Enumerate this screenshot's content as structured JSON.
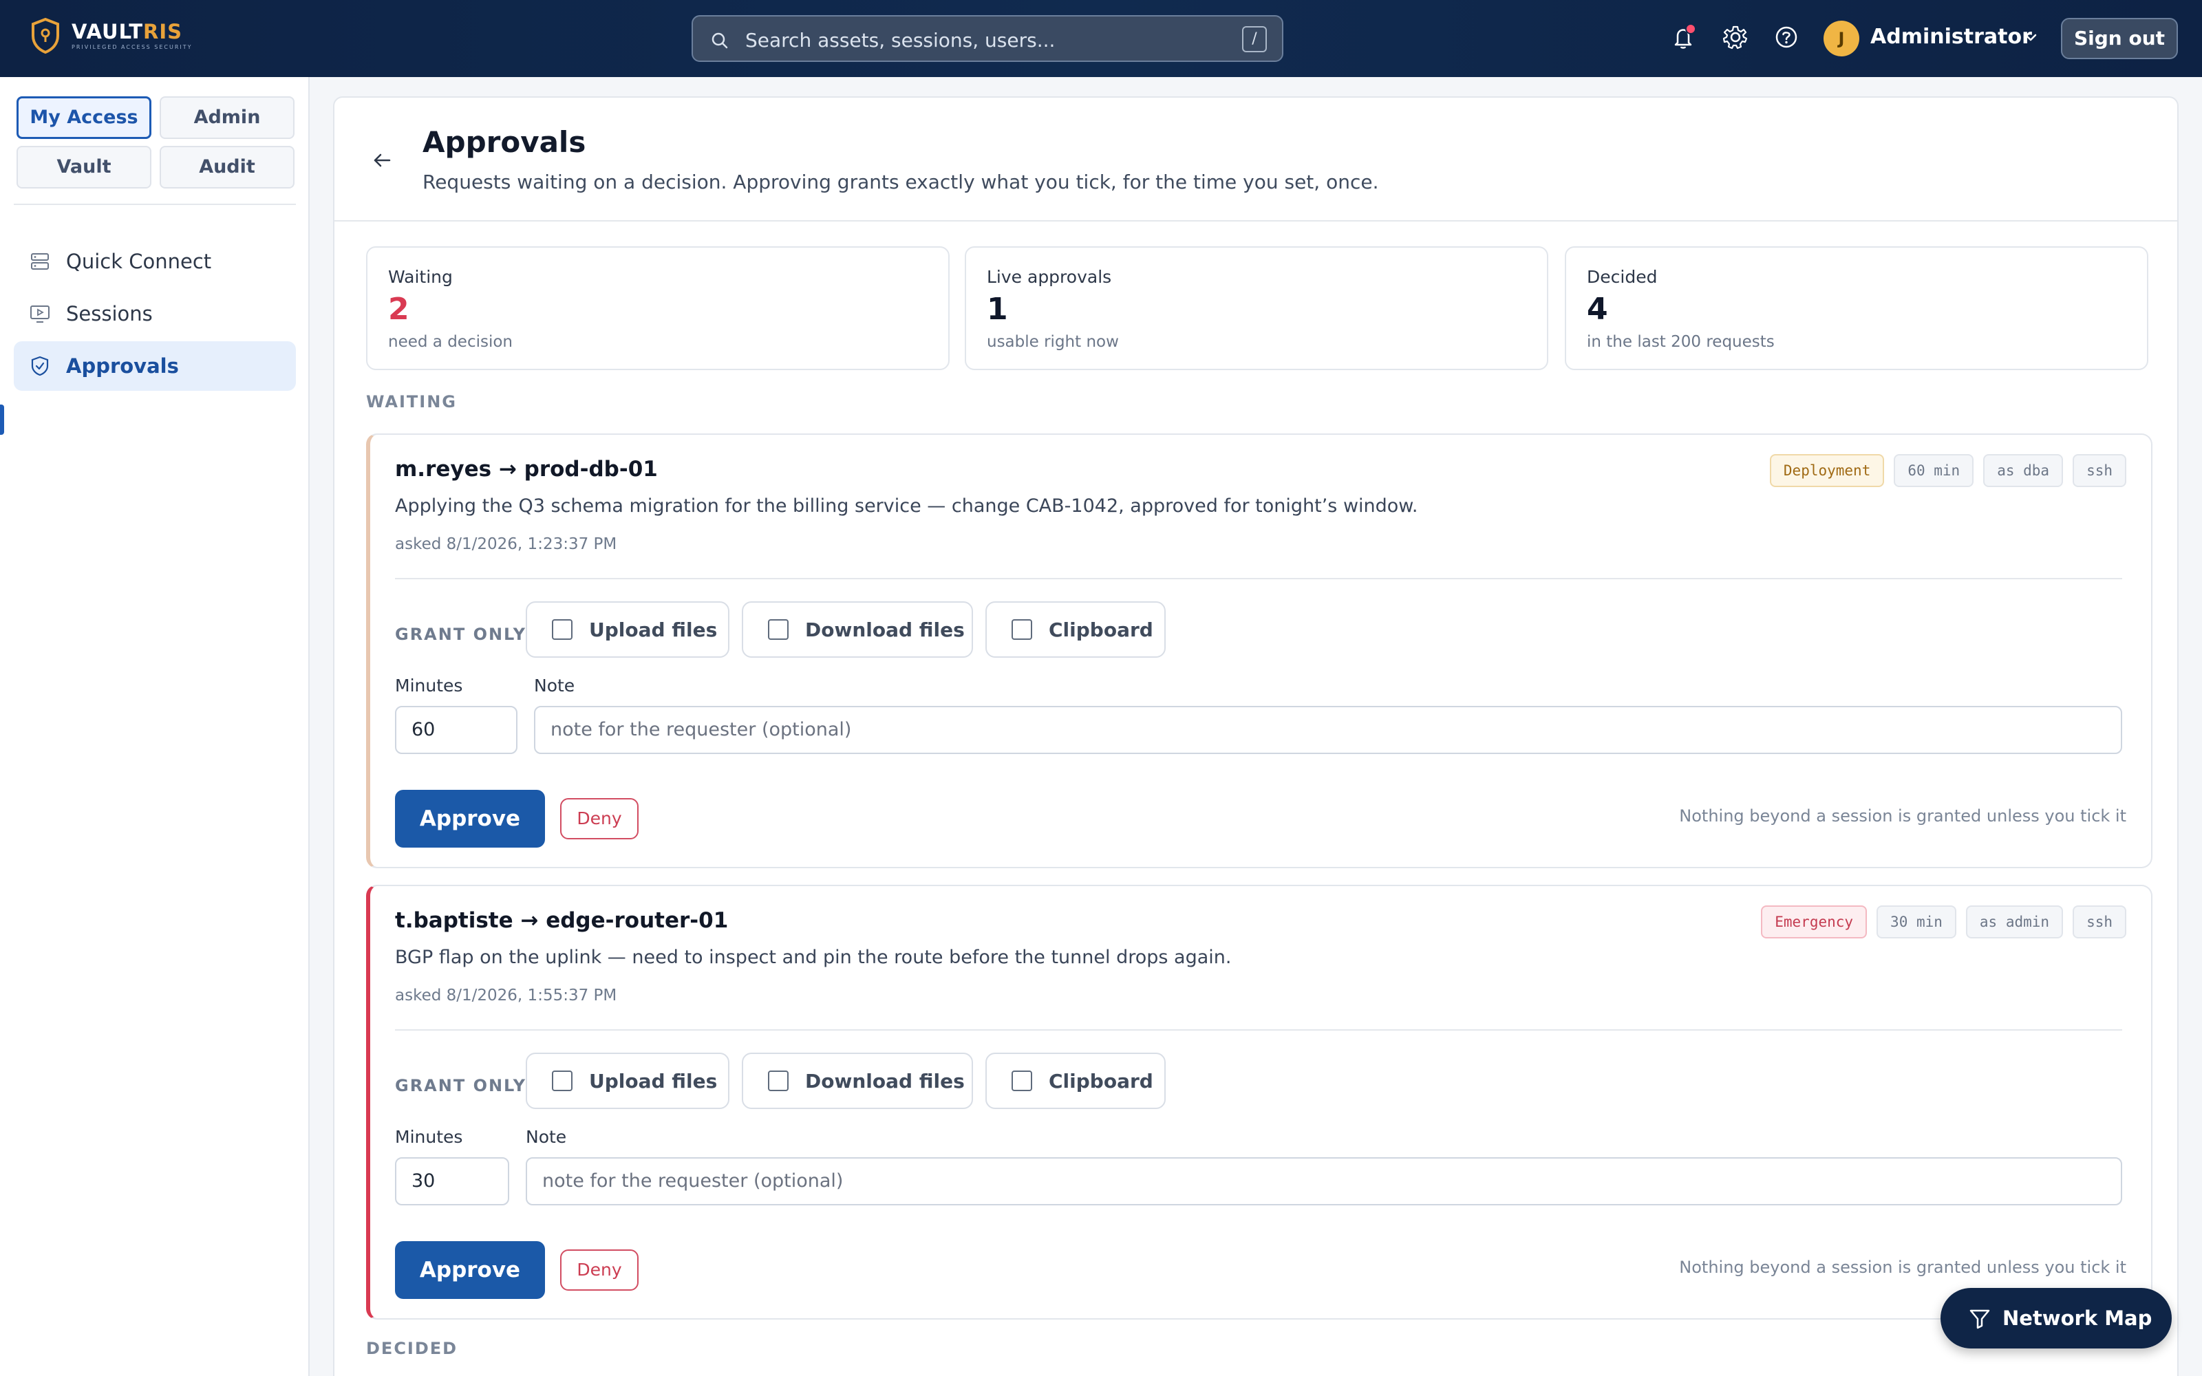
{
  "brand": {
    "name_part1": "VAULT",
    "name_part2": "RIS",
    "tagline": "PRIVILEGED ACCESS SECURITY"
  },
  "topbar": {
    "search_placeholder": "Search assets, sessions, users...",
    "search_shortcut": "/",
    "user_initial": "J",
    "user_name": "Administrator",
    "sign_out": "Sign out",
    "notification_dot_color": "#ff4f6e"
  },
  "sidebar": {
    "segments": [
      {
        "label": "My Access",
        "active": true
      },
      {
        "label": "Admin",
        "active": false
      },
      {
        "label": "Vault",
        "active": false
      },
      {
        "label": "Audit",
        "active": false
      }
    ],
    "items": [
      {
        "label": "Quick Connect",
        "icon": "server-icon"
      },
      {
        "label": "Sessions",
        "icon": "monitor-icon"
      },
      {
        "label": "Approvals",
        "icon": "shield-check-icon",
        "active": true
      }
    ]
  },
  "page": {
    "title": "Approvals",
    "subtitle": "Requests waiting on a decision. Approving grants exactly what you tick, for the time you set, once."
  },
  "stats": [
    {
      "label": "Waiting",
      "value": "2",
      "sub": "need a decision"
    },
    {
      "label": "Live approvals",
      "value": "1",
      "sub": "usable right now"
    },
    {
      "label": "Decided",
      "value": "4",
      "sub": "in the last 200 requests"
    }
  ],
  "sections": {
    "waiting": "WAITING",
    "decided": "DECIDED"
  },
  "requests": [
    {
      "title": "m.reyes → prod-db-01",
      "reason": "Applying the Q3 schema migration for the billing service — change CAB-1042, approved for tonight’s window.",
      "asked": "asked 8/1/2026, 1:23:37 PM",
      "badges": [
        "Deployment",
        "60 min",
        "as dba",
        "ssh"
      ],
      "grant_label": "GRANT ONLY",
      "grant_options": [
        "Upload files",
        "Download files",
        "Clipboard"
      ],
      "minutes_label": "Minutes",
      "minutes_value": "60",
      "note_label": "Note",
      "note_placeholder": "note for the requester (optional)",
      "approve": "Approve",
      "deny": "Deny",
      "hint": "Nothing beyond a session is granted unless you tick it"
    },
    {
      "title": "t.baptiste → edge-router-01",
      "reason": "BGP flap on the uplink — need to inspect and pin the route before the tunnel drops again.",
      "asked": "asked 8/1/2026, 1:55:37 PM",
      "badges": [
        "Emergency",
        "30 min",
        "as admin",
        "ssh"
      ],
      "grant_label": "GRANT ONLY",
      "grant_options": [
        "Upload files",
        "Download files",
        "Clipboard"
      ],
      "minutes_label": "Minutes",
      "minutes_value": "30",
      "note_label": "Note",
      "note_placeholder": "note for the requester (optional)",
      "approve": "Approve",
      "deny": "Deny",
      "hint": "Nothing beyond a session is granted unless you tick it"
    }
  ],
  "network_map": "Network Map",
  "colors": {
    "accent": "#1b59a8",
    "danger": "#d93a52",
    "topbar": "#0f2648"
  }
}
